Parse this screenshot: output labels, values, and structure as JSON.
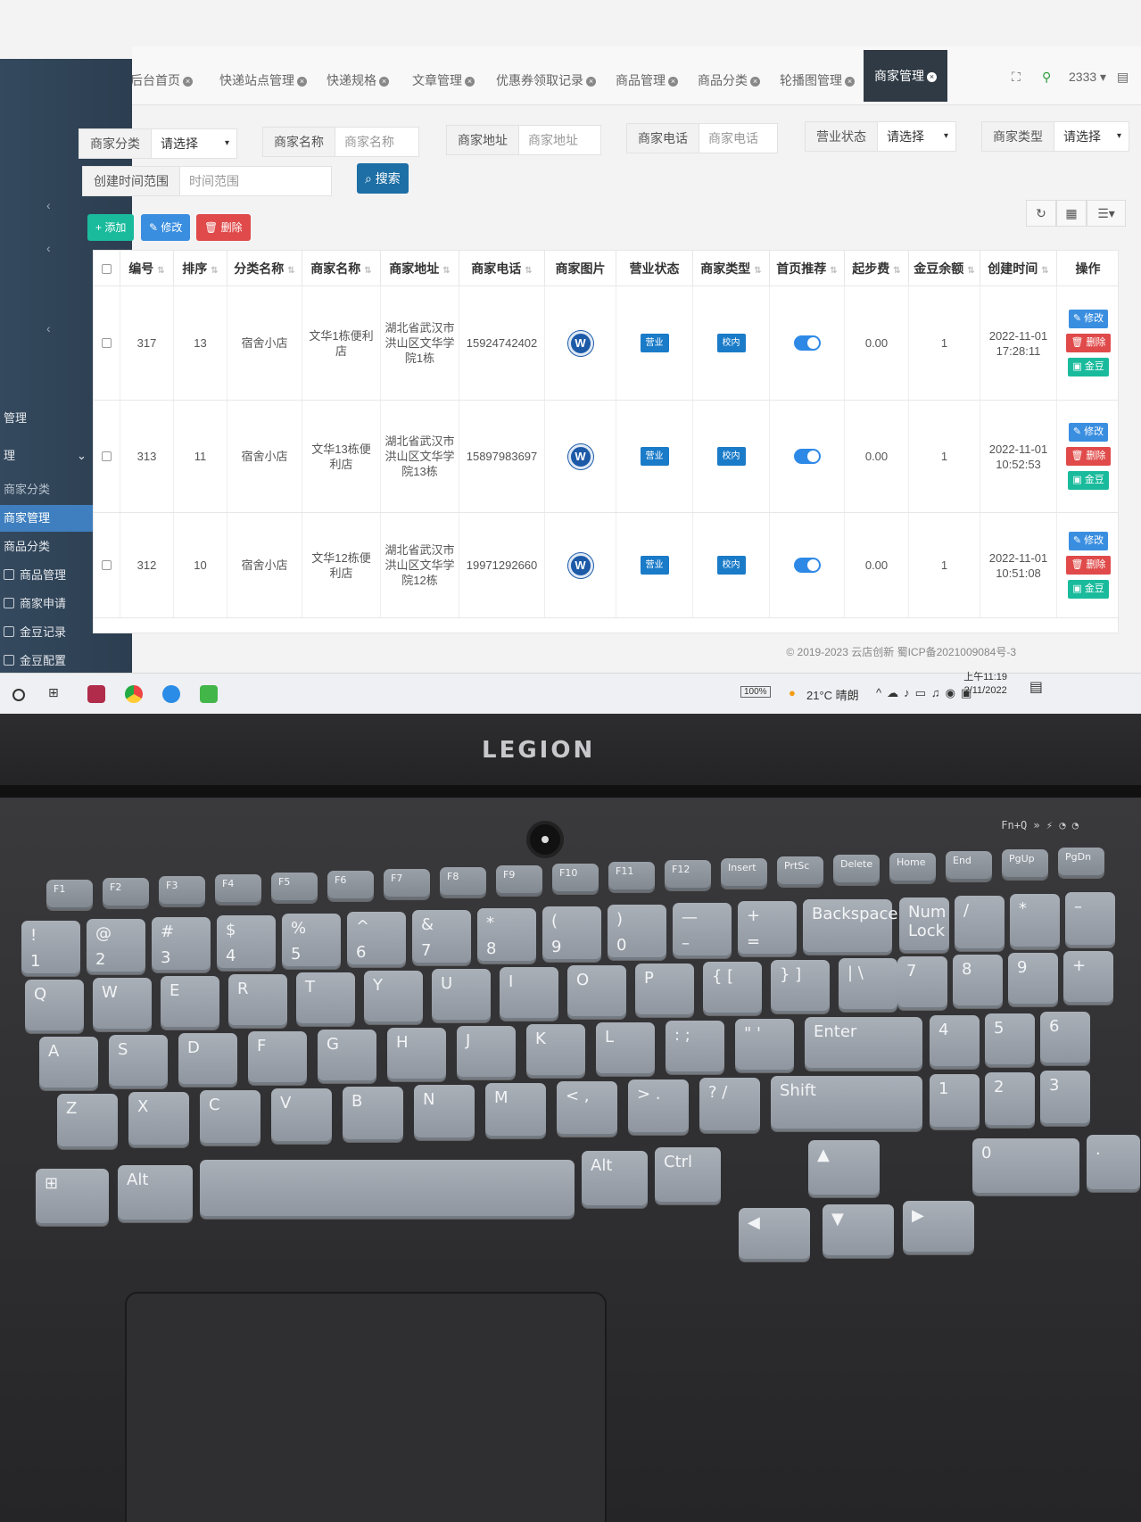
{
  "tabs": [
    {
      "label": "后台首页"
    },
    {
      "label": "快递站点管理"
    },
    {
      "label": "快递规格"
    },
    {
      "label": "文章管理"
    },
    {
      "label": "优惠券领取记录"
    },
    {
      "label": "商品管理"
    },
    {
      "label": "商品分类"
    },
    {
      "label": "轮播图管理"
    },
    {
      "label": "商家管理",
      "active": true
    }
  ],
  "user": {
    "name": "2333 ▾"
  },
  "sidebar": {
    "items": [
      {
        "label": "管理"
      },
      {
        "label": "理"
      },
      {
        "label": "商家分类"
      },
      {
        "label": "商家管理",
        "active": true
      },
      {
        "label": "商品分类"
      },
      {
        "label": "商品管理"
      },
      {
        "label": "商家申请"
      },
      {
        "label": "金豆记录"
      },
      {
        "label": "金豆配置"
      }
    ]
  },
  "filters": {
    "category": {
      "label": "商家分类",
      "value": "请选择"
    },
    "name": {
      "label": "商家名称",
      "placeholder": "商家名称"
    },
    "address": {
      "label": "商家地址",
      "placeholder": "商家地址"
    },
    "phone": {
      "label": "商家电话",
      "placeholder": "商家电话"
    },
    "status": {
      "label": "营业状态",
      "value": "请选择"
    },
    "type": {
      "label": "商家类型",
      "value": "请选择"
    },
    "created": {
      "label": "创建时间范围",
      "placeholder": "时间范围"
    },
    "search_label": "搜索"
  },
  "toolbar": {
    "add_label": "添加",
    "edit_label": "修改",
    "delete_label": "删除"
  },
  "table": {
    "columns": [
      "编号",
      "排序",
      "分类名称",
      "商家名称",
      "商家地址",
      "商家电话",
      "商家图片",
      "营业状态",
      "商家类型",
      "首页推荐",
      "起步费",
      "金豆余额",
      "创建时间",
      "操作"
    ],
    "rows": [
      {
        "id": "317",
        "sort": "13",
        "category": "宿舍小店",
        "name": "文华1栋便利店",
        "address": "湖北省武汉市洪山区文华学院1栋",
        "phone": "15924742402",
        "status": "营业",
        "type": "校内",
        "recommend": true,
        "fee": "0.00",
        "coins": "1",
        "created_date": "2022-11-01",
        "created_time": "17:28:11"
      },
      {
        "id": "313",
        "sort": "11",
        "category": "宿舍小店",
        "name": "文华13栋便利店",
        "address": "湖北省武汉市洪山区文华学院13栋",
        "phone": "15897983697",
        "status": "营业",
        "type": "校内",
        "recommend": true,
        "fee": "0.00",
        "coins": "1",
        "created_date": "2022-11-01",
        "created_time": "10:52:53"
      },
      {
        "id": "312",
        "sort": "10",
        "category": "宿舍小店",
        "name": "文华12栋便利店",
        "address": "湖北省武汉市洪山区文华学院12栋",
        "phone": "19971292660",
        "status": "营业",
        "type": "校内",
        "recommend": true,
        "fee": "0.00",
        "coins": "1",
        "created_date": "2022-11-01",
        "created_time": "10:51:08"
      }
    ],
    "op_labels": {
      "edit": "修改",
      "delete": "删除",
      "coin": "金豆"
    }
  },
  "footer": "© 2019-2023 云店创新 蜀ICP备2021009084号-3",
  "taskbar": {
    "battery": "100%",
    "weather": "21°C 晴朗",
    "time": "上午11:19",
    "date": "2/11/2022"
  },
  "laptop": {
    "brand": "LEGION"
  },
  "keyboard": {
    "row_fn": [
      "F1",
      "F2",
      "F3",
      "F4",
      "F5",
      "F6",
      "F7",
      "F8",
      "F9",
      "F10",
      "F11",
      "F12",
      "Insert",
      "PrtSc",
      "Delete",
      "Home",
      "End",
      "PgUp",
      "PgDn"
    ],
    "row_num": [
      [
        "!",
        "1"
      ],
      [
        "@",
        "2"
      ],
      [
        "#",
        "3"
      ],
      [
        "$",
        "4"
      ],
      [
        "%",
        "5"
      ],
      [
        "^",
        "6"
      ],
      [
        "&",
        "7"
      ],
      [
        "*",
        "8"
      ],
      [
        "(",
        "9"
      ],
      [
        ")",
        "0"
      ],
      [
        "—",
        "–"
      ],
      [
        "+",
        "="
      ],
      [
        "Backspace",
        ""
      ],
      [
        "Num Lock",
        ""
      ],
      [
        "/",
        ""
      ],
      [
        "*",
        ""
      ],
      [
        "–",
        ""
      ]
    ],
    "row_q": [
      "Q",
      "W",
      "E",
      "R",
      "T",
      "Y",
      "U",
      "I",
      "O",
      "P",
      "{ [",
      "} ]",
      "| \\",
      "7",
      "8",
      "9",
      "+"
    ],
    "row_a": [
      "A",
      "S",
      "D",
      "F",
      "G",
      "H",
      "J",
      "K",
      "L",
      ": ;",
      "\" '",
      "Enter",
      "4",
      "5",
      "6"
    ],
    "row_z": [
      "Z",
      "X",
      "C",
      "V",
      "B",
      "N",
      "M",
      "< ,",
      "> .",
      "? /",
      "Shift",
      "1",
      "2",
      "3"
    ],
    "row_bottom": [
      "Alt",
      "Alt",
      "Ctrl",
      "0",
      "."
    ]
  }
}
